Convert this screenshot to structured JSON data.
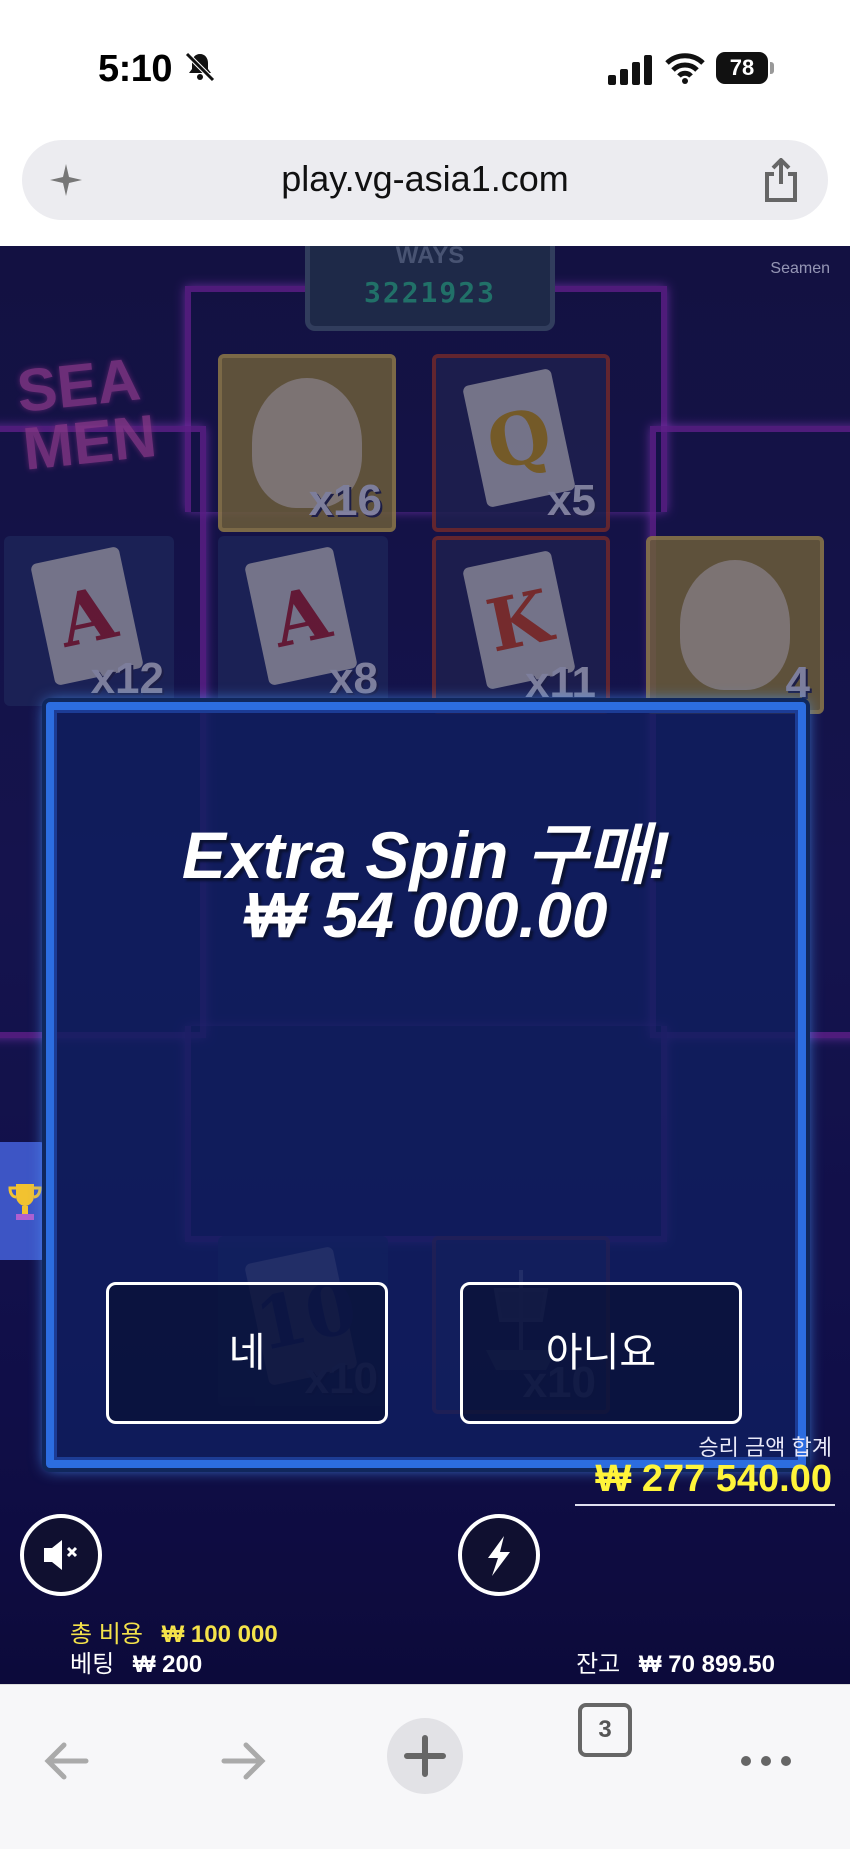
{
  "status_bar": {
    "time": "5:10",
    "battery": "78"
  },
  "browser": {
    "url": "play.vg-asia1.com",
    "tabs_count": "3"
  },
  "game": {
    "name_tag": "Seamen",
    "ways_label": "WAYS",
    "ways_count": "3221923",
    "logo_line1": "SEA",
    "logo_line2": "MEN",
    "tiles": [
      {
        "symbol": "sailor",
        "mult": "x16"
      },
      {
        "symbol": "Q",
        "mult": "x5"
      },
      {
        "symbol": "A",
        "mult": "x12"
      },
      {
        "symbol": "A",
        "mult": "x8"
      },
      {
        "symbol": "K",
        "mult": "x11"
      },
      {
        "symbol": "sailor",
        "mult": "4"
      },
      {
        "symbol": "10",
        "mult": "x10"
      },
      {
        "symbol": "ship",
        "mult": "x10"
      }
    ],
    "modal": {
      "title": "Extra Spin 구매!",
      "amount": "₩ 54 000.00",
      "yes_label": "네",
      "no_label": "아니요"
    },
    "hud": {
      "win_label": "승리 금액 합계",
      "win_amount": "₩ 277 540.00",
      "total_cost_label": "총 비용",
      "total_cost_value": "₩ 100 000",
      "bet_label": "베팅",
      "bet_value": "₩ 200",
      "balance_label": "잔고",
      "balance_value": "₩ 70 899.50"
    }
  },
  "colors": {
    "modal_border": "#2c6de0",
    "win_amount": "#fff43a",
    "neon": "#8d2bbd"
  }
}
